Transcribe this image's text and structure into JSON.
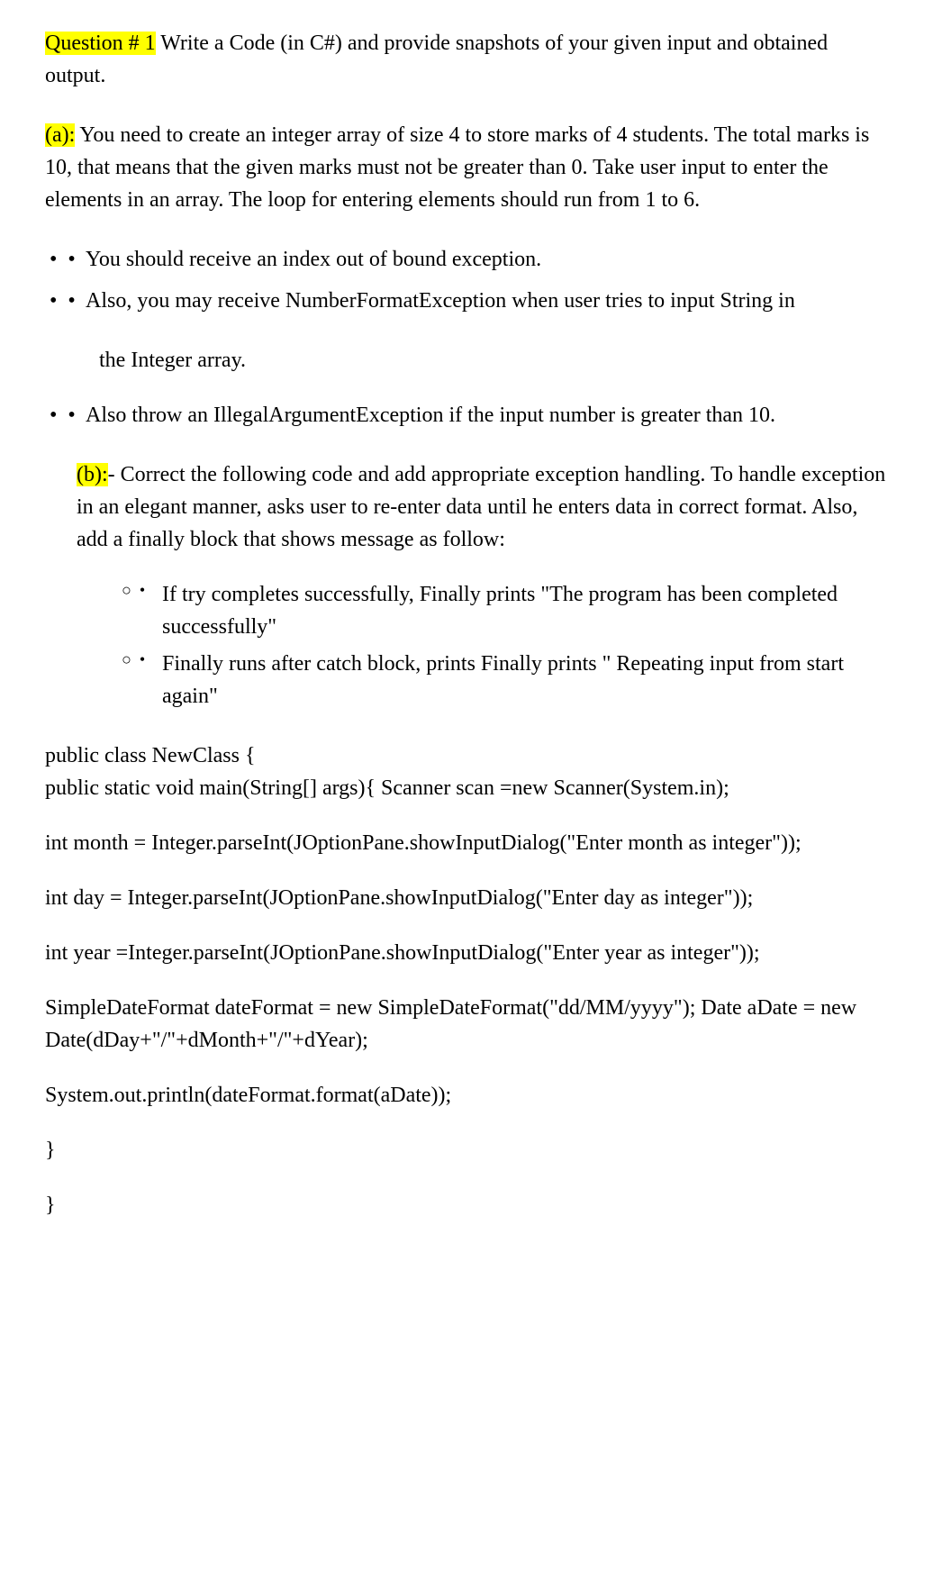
{
  "question": {
    "label": "Question # 1",
    "intro": " Write a Code (in C#) and provide snapshots of your given input and obtained output."
  },
  "partA": {
    "label": "(a):",
    "text": " You need to create an integer array of size 4 to store marks of 4 students. The total marks is 10, that means that the given marks must not be greater than 0. Take user input to enter the elements in an array. The loop for entering elements should run from 1 to 6.",
    "bullets": [
      " You should receive an index out of bound exception.",
      " Also, you may receive NumberFormatException when user tries to input String in",
      " Also throw an IllegalArgumentException if the input number is greater than 10."
    ],
    "continuation": "the Integer array."
  },
  "partB": {
    "label": "(b):",
    "text": "- Correct the following code and add appropriate exception handling. To handle exception in an elegant manner, asks user to re-enter data until he enters data in correct format. Also, add a finally block that shows message as follow:",
    "subBullets": [
      " If try completes successfully, Finally prints \"The program has been completed successfully\"",
      " Finally runs after catch block, prints Finally prints \" Repeating input from start again\""
    ]
  },
  "code": {
    "line1": " public class NewClass {",
    "line2": "public static void main(String[] args){ Scanner scan =new Scanner(System.in);",
    "line3": "int month = Integer.parseInt(JOptionPane.showInputDialog(\"Enter month as integer\"));",
    "line4": "int day = Integer.parseInt(JOptionPane.showInputDialog(\"Enter day as integer\"));",
    "line5": "int year =Integer.parseInt(JOptionPane.showInputDialog(\"Enter year as integer\"));",
    "line6": "SimpleDateFormat dateFormat = new SimpleDateFormat(\"dd/MM/yyyy\"); Date aDate = new Date(dDay+\"/\"+dMonth+\"/\"+dYear);",
    "line7": "System.out.println(dateFormat.format(aDate));",
    "line8": " }",
    "line9": "}"
  }
}
